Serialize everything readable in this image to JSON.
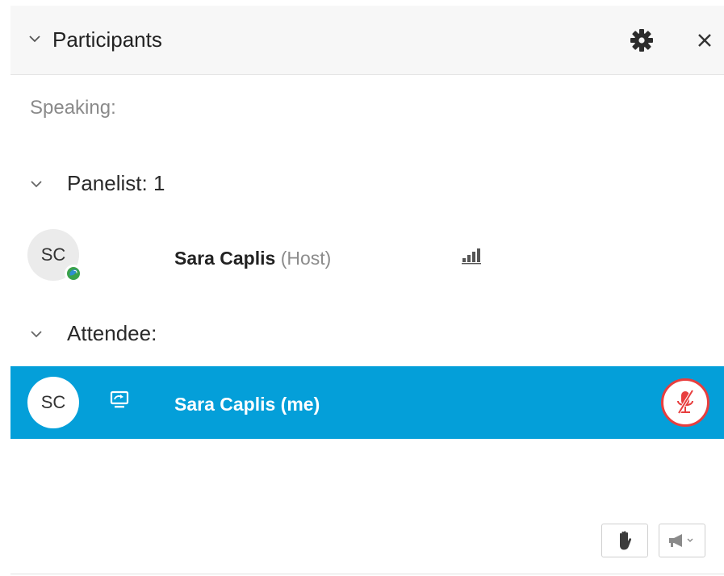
{
  "header": {
    "title": "Participants",
    "icons": {
      "collapse": "chevron-down-icon",
      "settings": "gear-icon",
      "close": "close-icon"
    }
  },
  "speaking_label": "Speaking:",
  "sections": {
    "panelist": {
      "label": "Panelist: 1"
    },
    "attendee": {
      "label": "Attendee:"
    }
  },
  "panelists": [
    {
      "initials": "SC",
      "name": "Sara Caplis",
      "role": "(Host)",
      "status_icon": "presence-online-icon",
      "audio_icon": "audio-signal-icon"
    }
  ],
  "attendees": [
    {
      "initials": "SC",
      "name": "Sara Caplis (me)",
      "device_icon": "desktop-share-icon",
      "audio_icon": "microphone-muted-icon",
      "selected": true
    }
  ],
  "footer": {
    "buttons": [
      {
        "icon": "raise-hand-icon"
      },
      {
        "icon": "megaphone-icon"
      }
    ]
  },
  "colors": {
    "selected_row": "#049fd9",
    "header_bg": "#f7f7f7",
    "mute_red": "#e83e3e",
    "presence_green": "#3aa24b",
    "presence_blue": "#2f8fd0"
  }
}
